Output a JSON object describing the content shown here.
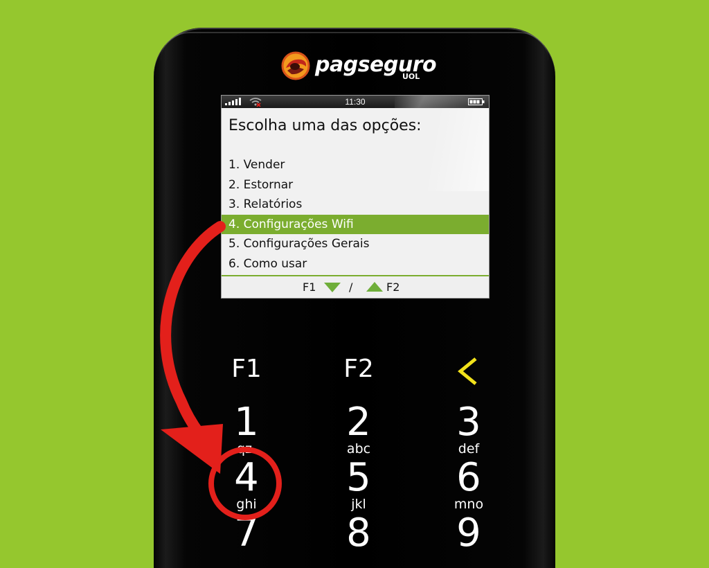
{
  "brand": {
    "name": "pagseguro",
    "sub": "UOL"
  },
  "status": {
    "time": "11:30"
  },
  "screen": {
    "heading": "Escolha uma das opções:",
    "menu": [
      "1. Vender",
      "2. Estornar",
      "3. Relatórios",
      "4. Configurações Wifi",
      "5. Configurações Gerais",
      "6. Como usar"
    ],
    "selected_index": 3,
    "footer": {
      "f1": "F1",
      "slash": "/",
      "f2": "F2"
    }
  },
  "keypad": {
    "f1": "F1",
    "f2": "F2",
    "keys": [
      {
        "num": "1",
        "letters": "qz."
      },
      {
        "num": "2",
        "letters": "abc"
      },
      {
        "num": "3",
        "letters": "def"
      },
      {
        "num": "4",
        "letters": "ghi"
      },
      {
        "num": "5",
        "letters": "jkl"
      },
      {
        "num": "6",
        "letters": "mno"
      },
      {
        "num": "7",
        "letters": ""
      },
      {
        "num": "8",
        "letters": ""
      },
      {
        "num": "9",
        "letters": ""
      }
    ]
  },
  "colors": {
    "background": "#95c72e",
    "selection": "#7bad2f",
    "annotation_red": "#e3201b",
    "back_key": "#f2e21b",
    "logo_orange": "#f39a1e"
  },
  "icons": {
    "signal": "signal-bars-icon",
    "wifi": "wifi-disconnected-icon",
    "battery": "battery-icon",
    "back": "chevron-left-icon",
    "annotation": "curved-arrow-icon"
  }
}
